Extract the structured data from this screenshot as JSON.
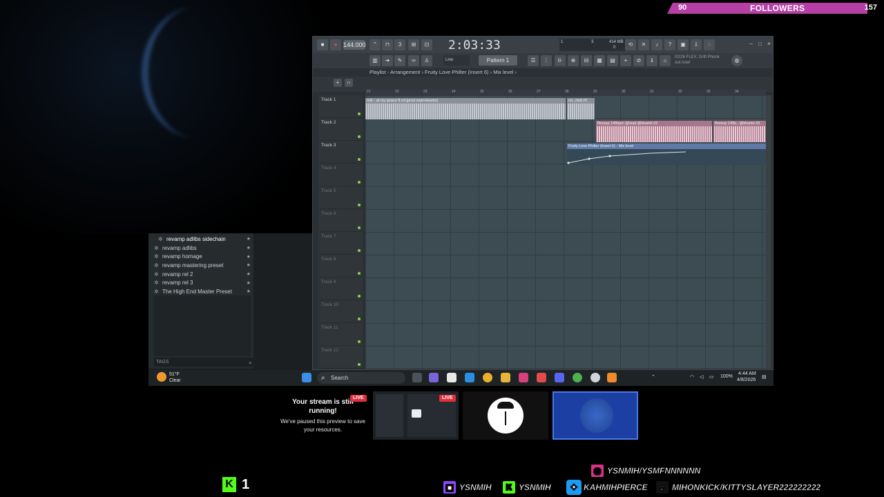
{
  "followers": {
    "current": "90",
    "label": "FOLLOWERS",
    "goal": "157",
    "bar_color": "#b53fa5"
  },
  "browser": {
    "items": [
      {
        "label": "revamp adlibs sidechain",
        "selected": true
      },
      {
        "label": "revamp adlibs"
      },
      {
        "label": "revamp homage"
      },
      {
        "label": "revamp mastering preset"
      },
      {
        "label": "revamp rel 2"
      },
      {
        "label": "revamp rel 3"
      },
      {
        "label": "The High End Master Preset"
      }
    ],
    "tags_label": "TAGS"
  },
  "fl": {
    "tempo": "144.000",
    "time": "2:03:33",
    "cpu_top_left": "1",
    "cpu_top_mid": "3",
    "cpu_mem": "414 MB",
    "cpu_bottom": "0",
    "line_mode": "Line",
    "pattern": "Pattern 1",
    "hint_line1": "02/26  FLEX: Drift Phonk",
    "hint_line2": "out now!",
    "playlist_title": "Playlist - Arrangement › Fruity Love Philter (Insert 6) › Mix level ›",
    "ruler": [
      "21",
      "22",
      "23",
      "24",
      "25",
      "26",
      "27",
      "28",
      "29",
      "30",
      "31",
      "32",
      "33",
      "34"
    ],
    "tracks": [
      "Track 1",
      "Track 2",
      "Track 3",
      "Track 4",
      "Track 5",
      "Track 6",
      "Track 7",
      "Track 8",
      "Track 9",
      "Track 10",
      "Track 11",
      "Track 12"
    ],
    "clips": {
      "c1": "mih - at my peace ft rel [prod sept+kkartel]",
      "c1b": "mi...rtel] #2",
      "c2": "flexxup 145bpm @sept @kkartel #2",
      "c2b": "flexxup 145b.. @kkartel #3",
      "c3": "Fruity Love Philter (Insert 6) - Mix level"
    }
  },
  "taskbar": {
    "weather_temp": "51°F",
    "weather_desc": "Clear",
    "search": "Search",
    "battery": "100%",
    "time": "4:44 AM",
    "date": "4/8/2026"
  },
  "paused": {
    "title": "Your stream is still running!",
    "sub": "We've paused this preview to save your resources.",
    "live": "LIVE"
  },
  "tile_live": "LIVE",
  "socials": {
    "instagram": "YSNMIH/YSMFNNNNNN",
    "twitch": "YSNMIH",
    "kick": "YSNMIH",
    "twitter": "KAHMIHPIERCE",
    "tiktok": "MIHONKICK/KITTYSLAYER222222222"
  },
  "kick_viewers": "1"
}
